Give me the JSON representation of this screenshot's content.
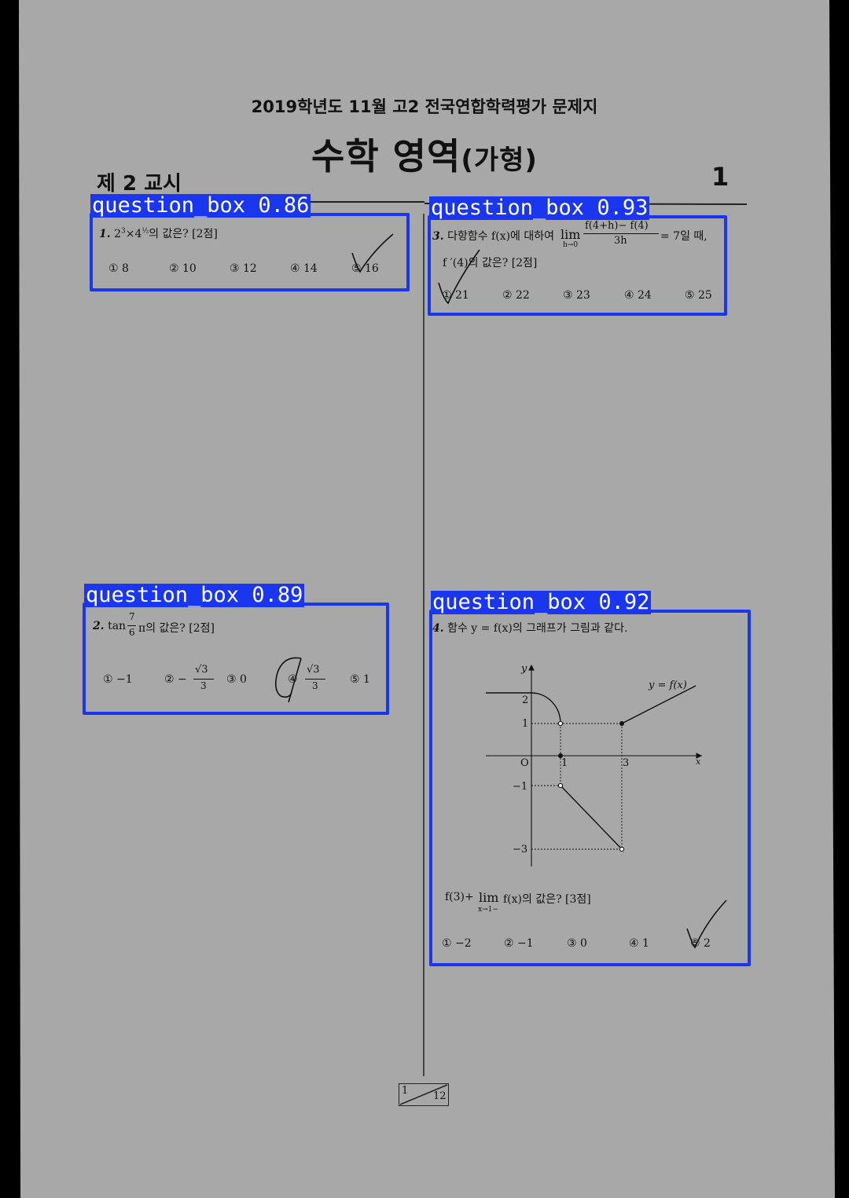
{
  "header": {
    "subtitle": "2019학년도 11월 고2 전국연합학력평가 문제지",
    "title_main": "수학 영역",
    "title_suffix": "(가형)",
    "period": "제 2 교시",
    "page_number": "1"
  },
  "questions": {
    "q1": {
      "num": "1.",
      "text_suffix": "의 값은? [2점]",
      "options": [
        "① 8",
        "② 10",
        "③ 12",
        "④ 14",
        "⑤ 16"
      ],
      "detection": "question_box 0.86"
    },
    "q2": {
      "num": "2.",
      "text_prefix": "tan",
      "frac_num": "7",
      "frac_den": "6",
      "text_suffix": "π의 값은? [2점]",
      "options": [
        "① −1",
        "② −",
        "③ 0",
        "④",
        "⑤ 1"
      ],
      "opt2_frac_den": "3",
      "opt4_frac_den": "3",
      "sqrt3": "√3",
      "detection": "question_box 0.89"
    },
    "q3": {
      "num": "3.",
      "text_a": "다항함수 f(x)에 대하여",
      "lim": "lim",
      "lim_sub": "h→0",
      "frac_num": "f(4+h)− f(4)",
      "frac_den": "3h",
      "text_b": "= 7일 때,",
      "text_c": "f ′(4)의 값은? [2점]",
      "options": [
        "① 21",
        "② 22",
        "③ 23",
        "④ 24",
        "⑤ 25"
      ],
      "detection": "question_box 0.93"
    },
    "q4": {
      "num": "4.",
      "text": "함수 y = f(x)의 그래프가 그림과 같다.",
      "graph": {
        "y_axis_label": "y",
        "x_axis_label": "x",
        "curve_label": "y = f(x)",
        "ticks_y": [
          "2",
          "1",
          "−1",
          "−3"
        ],
        "ticks_x": [
          "1",
          "3"
        ],
        "origin": "O"
      },
      "ask_a": "f(3)+",
      "ask_lim": "lim",
      "ask_lim_sub": "x→1−",
      "ask_b": "f(x)의 값은? [3점]",
      "options": [
        "① −2",
        "② −1",
        "③ 0",
        "④ 1",
        "⑤ 2"
      ],
      "detection": "question_box 0.92"
    }
  },
  "footer": {
    "page": "1",
    "total": "12"
  },
  "colors": {
    "paper": "#a8a8a8",
    "background": "#000000",
    "detection": "#1a36f0",
    "ink": "#111111"
  }
}
